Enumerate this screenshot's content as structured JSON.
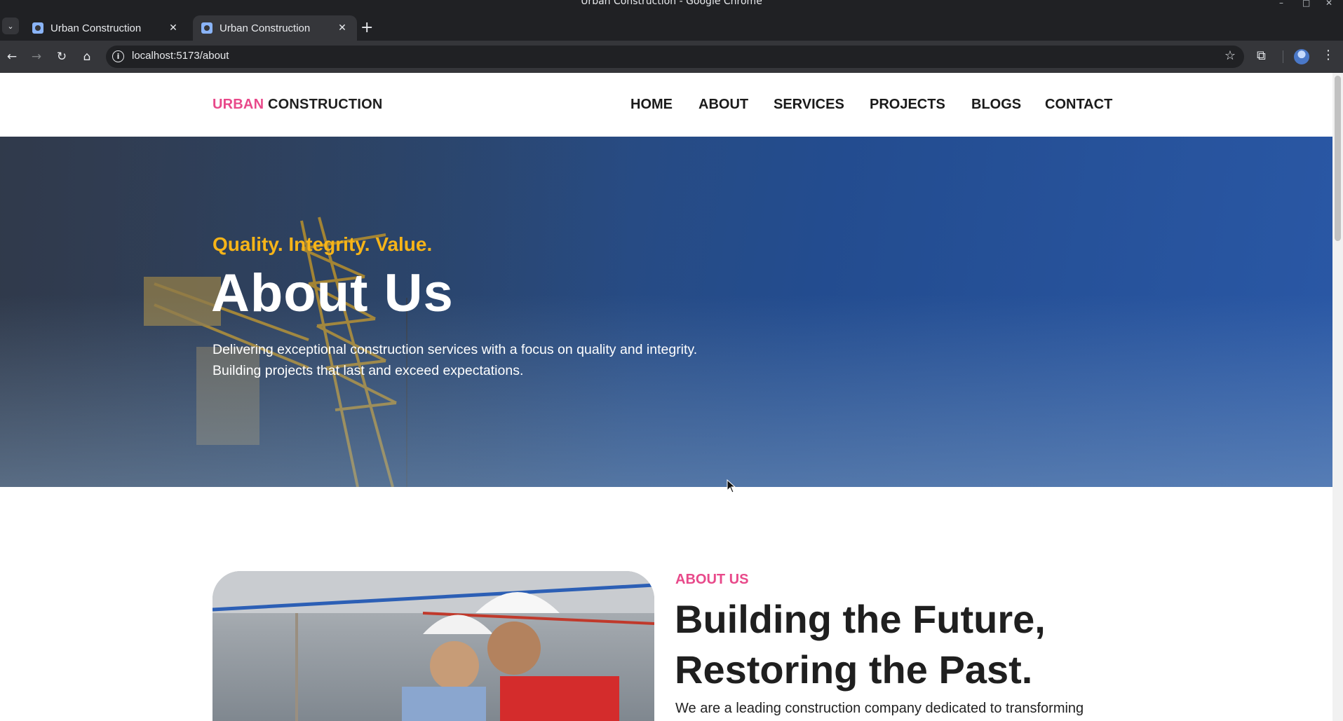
{
  "window": {
    "title": "Urban Construction - Google Chrome"
  },
  "tabs": [
    {
      "label": "Urban Construction",
      "active": false
    },
    {
      "label": "Urban Construction",
      "active": true
    }
  ],
  "toolbar": {
    "url": "localhost:5173/about"
  },
  "site": {
    "logo_accent": "URBAN",
    "logo_main": "CONSTRUCTION",
    "nav": [
      "HOME",
      "ABOUT",
      "SERVICES",
      "PROJECTS",
      "BLOGS",
      "CONTACT"
    ]
  },
  "hero": {
    "tagline": "Quality. Integrity. Value.",
    "title": "About Us",
    "description_line1": "Delivering exceptional construction services with a focus on quality and integrity.",
    "description_line2": "Building projects that last and exceed expectations."
  },
  "about": {
    "eyebrow": "ABOUT US",
    "heading_line1": "Building the Future,",
    "heading_line2": "Restoring the Past.",
    "text": "We are a leading construction company dedicated to transforming"
  },
  "colors": {
    "brand_pink": "#e8498a",
    "tagline_gold": "#f6b418",
    "hero_blue": "#234c8f"
  }
}
